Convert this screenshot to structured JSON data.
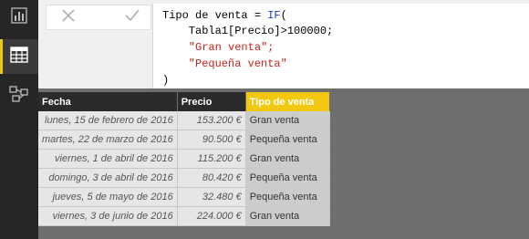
{
  "sidebar": {
    "items": [
      {
        "name": "report-view",
        "icon": "bar-chart-icon"
      },
      {
        "name": "data-view",
        "icon": "table-grid-icon",
        "active": true
      },
      {
        "name": "relationships-view",
        "icon": "relationships-icon"
      }
    ]
  },
  "formula_bar": {
    "cancel_icon": "close-icon",
    "commit_icon": "check-icon",
    "line1_prefix": "Tipo de venta = ",
    "line1_fn": "IF",
    "line1_suffix": "(",
    "line2": "    Tabla1[Precio]>100000;",
    "line3": "    \"Gran venta\";",
    "line4": "    \"Pequeña venta\"",
    "line5": ")"
  },
  "table": {
    "headers": [
      "Fecha",
      "Precio",
      "Tipo de venta"
    ],
    "rows": [
      [
        "lunes, 15 de febrero de 2016",
        "153.200 €",
        "Gran venta"
      ],
      [
        "martes, 22 de marzo de 2016",
        "90.500 €",
        "Pequeña venta"
      ],
      [
        "viernes, 1 de abril de 2016",
        "115.200 €",
        "Gran venta"
      ],
      [
        "domingo, 3 de abril de 2016",
        "80.420 €",
        "Pequeña venta"
      ],
      [
        "jueves, 5 de mayo de 2016",
        "32.480 €",
        "Pequeña venta"
      ],
      [
        "viernes, 3 de junio de 2016",
        "224.000 €",
        "Gran venta"
      ]
    ]
  },
  "colors": {
    "accent": "#f2c811",
    "sidebar": "#262626",
    "function": "#0b3fd0",
    "string": "#c9231b"
  }
}
